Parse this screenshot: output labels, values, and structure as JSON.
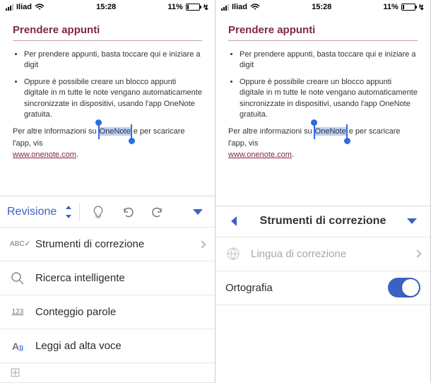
{
  "status": {
    "carrier": "Iliad",
    "time": "15:28",
    "battery": "11%"
  },
  "doc": {
    "heading": "Prendere appunti",
    "bullet1": "Per prendere appunti, basta toccare qui e iniziare a digit",
    "bullet2_a": "Oppure è possibile creare un blocco appunti digitale in m",
    "bullet2_b": "tutte le note vengano automaticamente sincronizzate in",
    "bullet2_c": "dispositivi, usando l'app OneNote gratuita.",
    "info_a": "Per altre informazioni su ",
    "sel": "OneNote",
    "info_b": " e per scaricare l'app, vis",
    "link": "www.onenote.com"
  },
  "left": {
    "tab": "Revisione",
    "rows": {
      "proofing": "Strumenti di correzione",
      "smart": "Ricerca intelligente",
      "wordcount": "Conteggio parole",
      "readaloud": "Leggi ad alta voce"
    },
    "icons": {
      "abc": "ABC",
      "count": "123"
    }
  },
  "right": {
    "title": "Strumenti di correzione",
    "lang": "Lingua di correzione",
    "spell": "Ortografia"
  }
}
